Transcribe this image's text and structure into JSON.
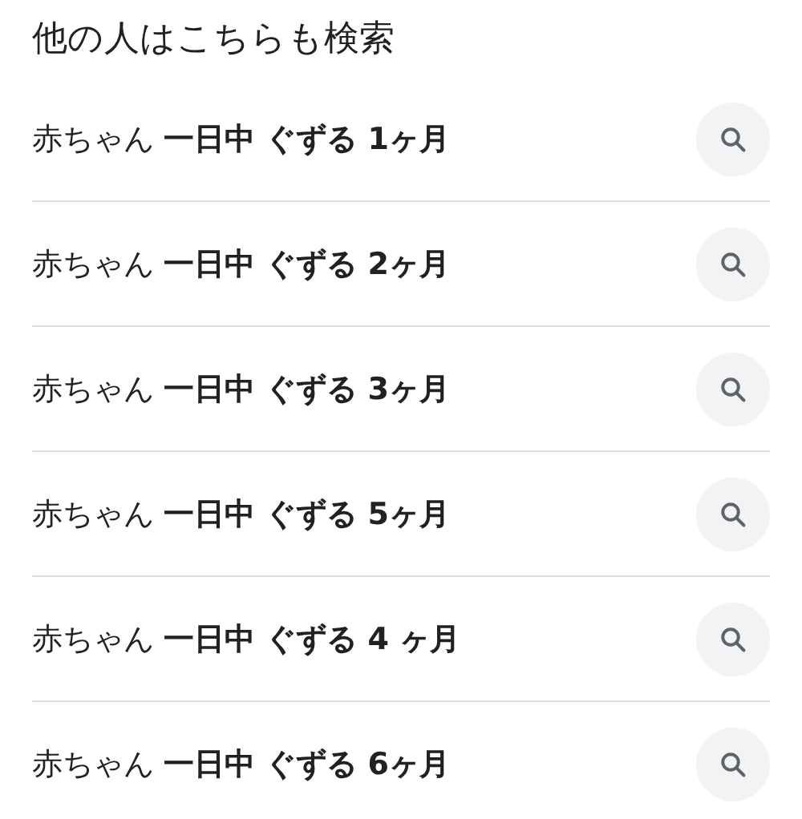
{
  "title": "他の人はこちらも検索",
  "items": [
    {
      "text": "赤ちゃん **一日中 ぐずる 1ヶ月**"
    },
    {
      "text": "赤ちゃん **一日中 ぐずる 2ヶ月**"
    },
    {
      "text": "赤ちゃん **一日中 ぐずる 3ヶ月**"
    },
    {
      "text": "赤ちゃん **一日中 ぐずる 5ヶ月**"
    },
    {
      "text": "赤ちゃん **一日中 ぐずる 4 ヶ月**"
    },
    {
      "text": "赤ちゃん **一日中 ぐずる 6ヶ月**"
    }
  ]
}
